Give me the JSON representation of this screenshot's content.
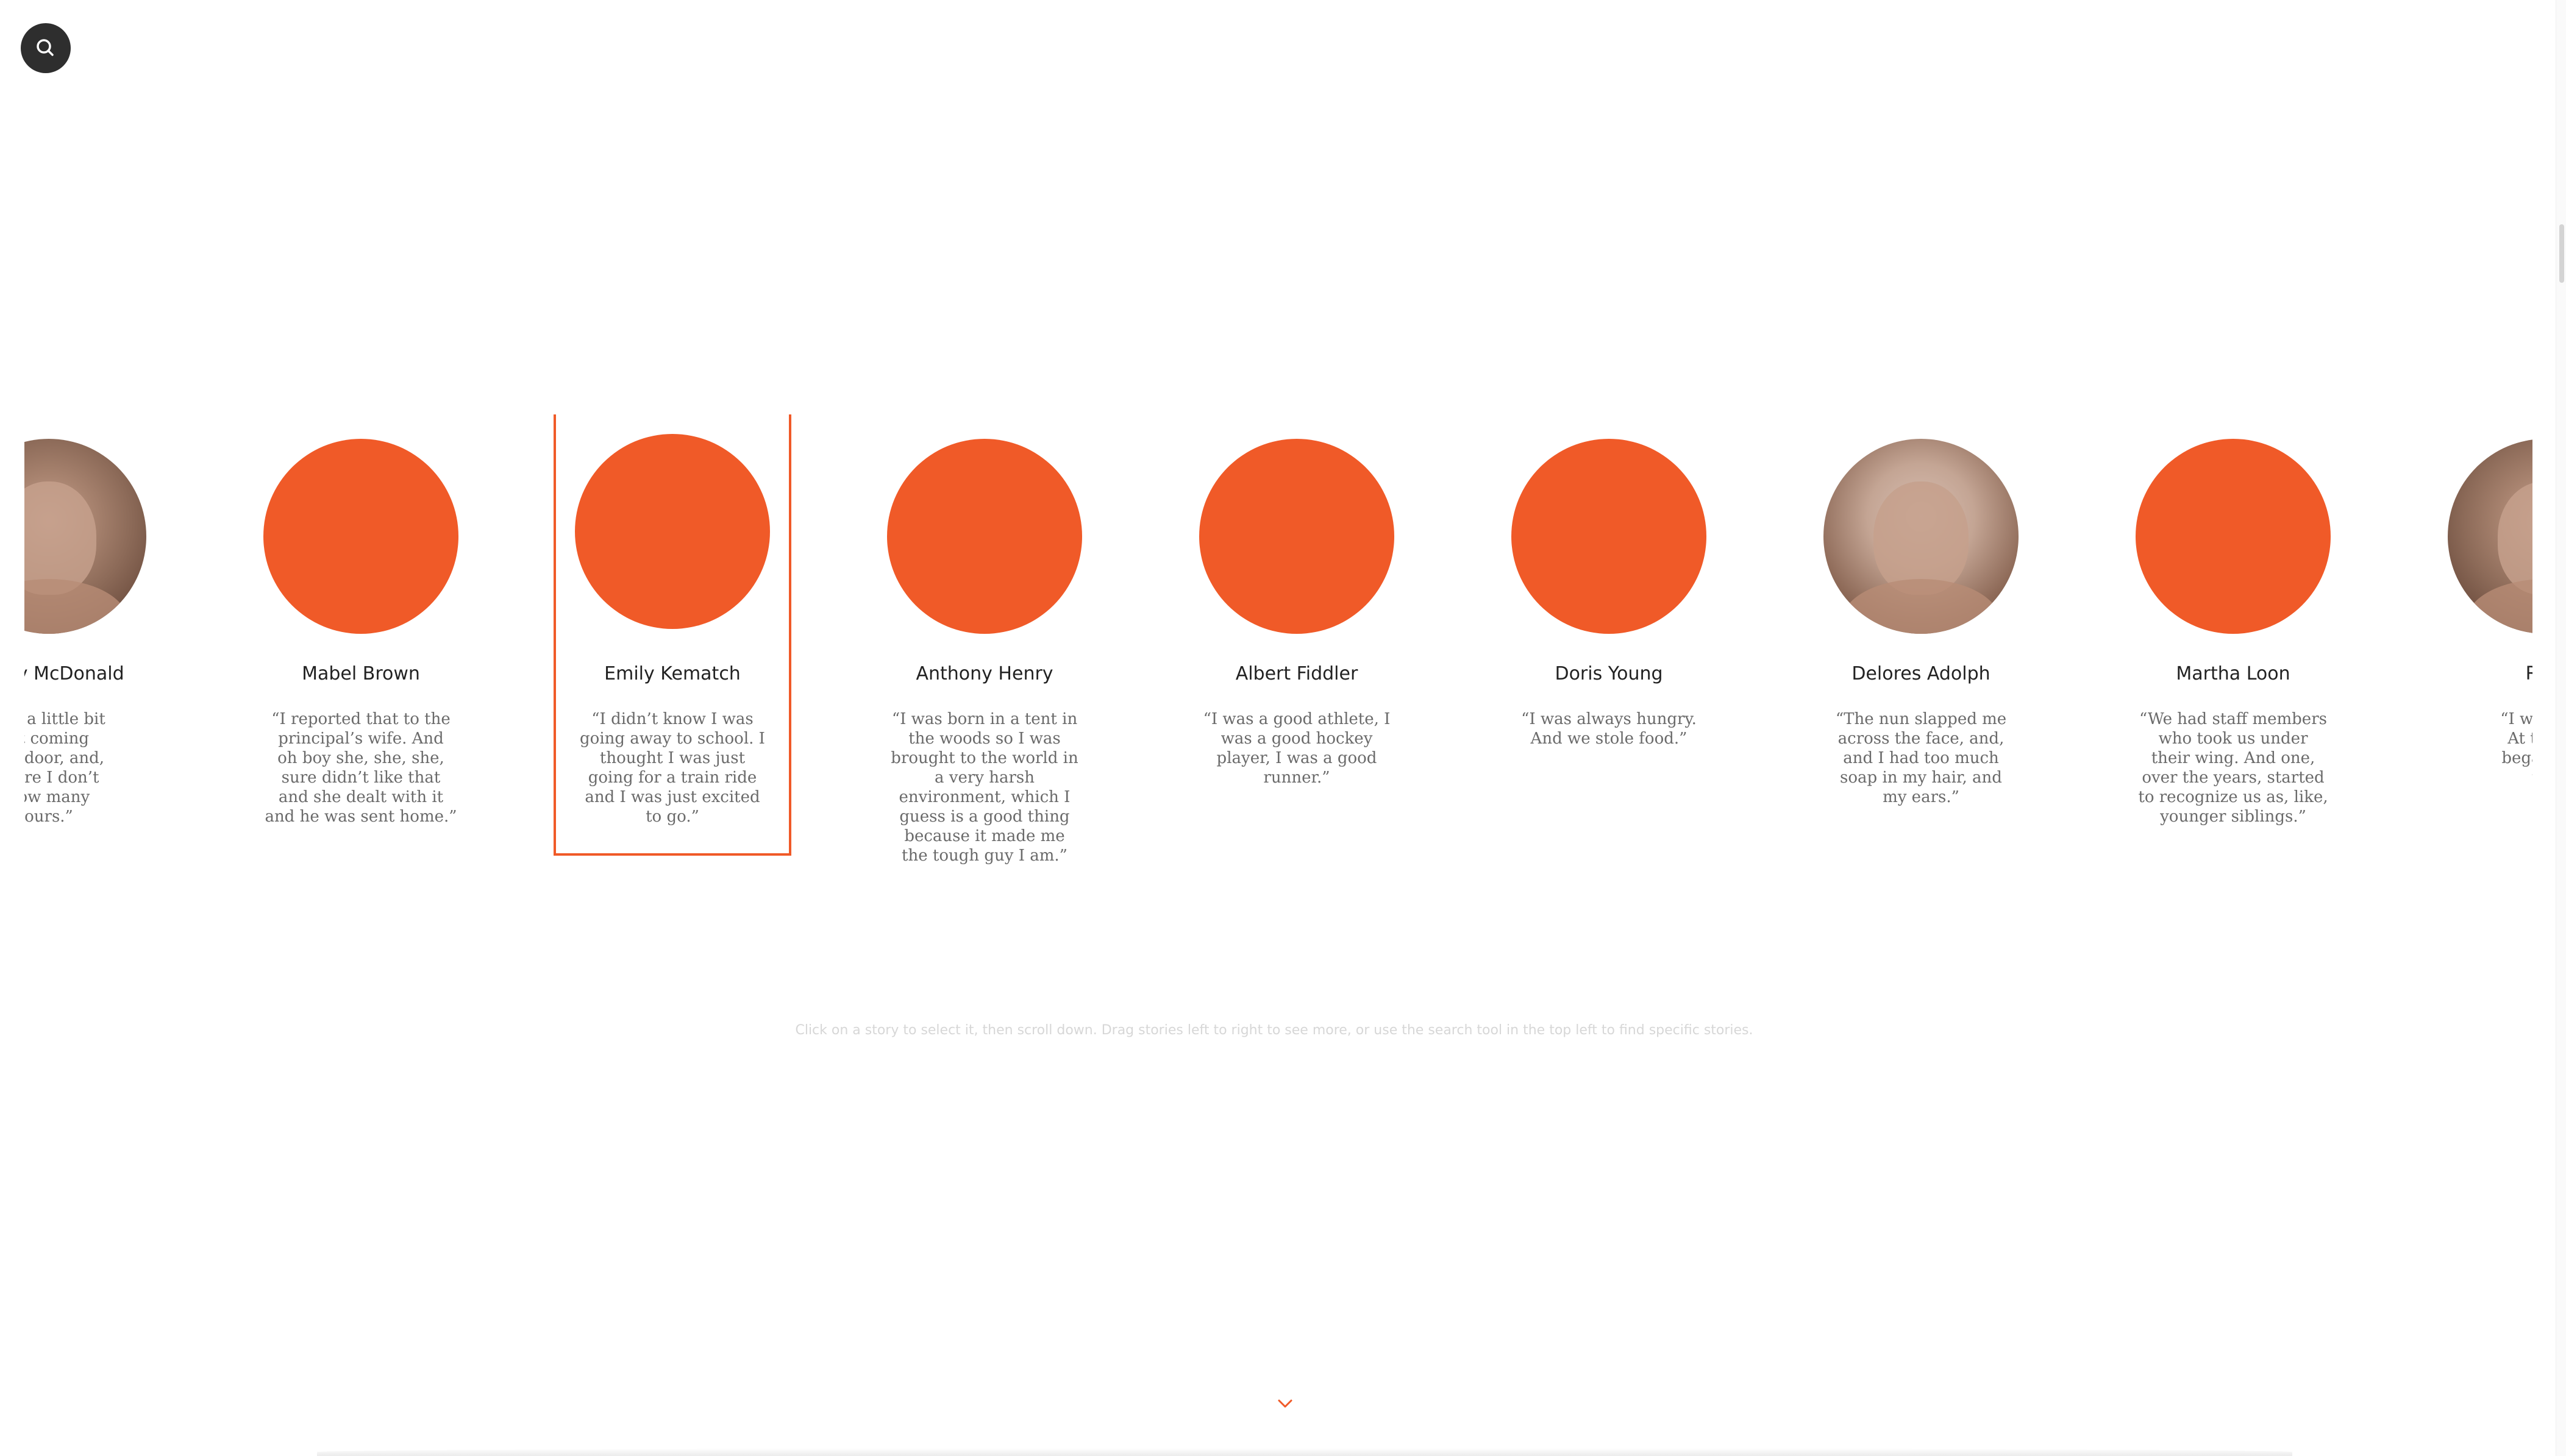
{
  "search": {
    "icon": "search-icon"
  },
  "stories": [
    {
      "name": "Abasay McDonald",
      "name_visible": "basay McDonald",
      "quote": "“It was just a little bit\nof light coming\nunder that door, and,\nyou sat there I don’t\nknow how many\nhours.”",
      "quote_visible": " just a little bit\nht coming\nhat door, and,\n there I don’t\n how many\nours.”",
      "photo": true,
      "selected": false
    },
    {
      "name": "Mabel Brown",
      "quote": "“I reported that to the\nprincipal’s wife. And\noh boy she, she, she,\nsure didn’t like that\nand she dealt with it\nand he was sent home.”",
      "photo": false,
      "selected": false
    },
    {
      "name": "Emily Kematch",
      "quote": "“I didn’t know I was\ngoing away to school. I\nthought I was just\ngoing for a train ride\nand I was just excited\nto go.”",
      "photo": false,
      "selected": true
    },
    {
      "name": "Anthony Henry",
      "quote": "“I was born in a tent in\nthe woods so I was\nbrought to the world in\na very harsh\nenvironment, which I\nguess is a good thing\nbecause it made me\nthe tough guy I am.”",
      "photo": false,
      "selected": false
    },
    {
      "name": "Albert Fiddler",
      "quote": "“I was a good athlete, I\nwas a good hockey\nplayer, I was a good\nrunner.”",
      "photo": false,
      "selected": false
    },
    {
      "name": "Doris Young",
      "quote": "“I was always hungry.\nAnd we stole food.”",
      "photo": false,
      "selected": false
    },
    {
      "name": "Delores Adolph",
      "quote": "“The nun slapped me\nacross the face, and,\nand I had too much\nsoap in my hair, and\nmy ears.”",
      "photo": true,
      "selected": false
    },
    {
      "name": "Martha Loon",
      "quote": "“We had staff members\nwho took us under\ntheir wing. And one,\nover the years, started\nto recognize us as, like,\nyounger siblings.”",
      "photo": false,
      "selected": false
    },
    {
      "name": "Rich",
      "quote": "“I was twel\nAt twelve\nbegan drin\nto f",
      "photo": true,
      "selected": false
    }
  ],
  "instruction": "Click on a story to select it, then scroll down. Drag stories left to right to see more, or use the search tool in the top left to find specific stories.",
  "scroll_down": {
    "icon": "chevron-down-icon"
  },
  "colors": {
    "accent": "#f05a28",
    "dark_button": "#2e2e2e",
    "quote_text": "#6a6a6a",
    "instruction_text": "#d7d7d7"
  }
}
